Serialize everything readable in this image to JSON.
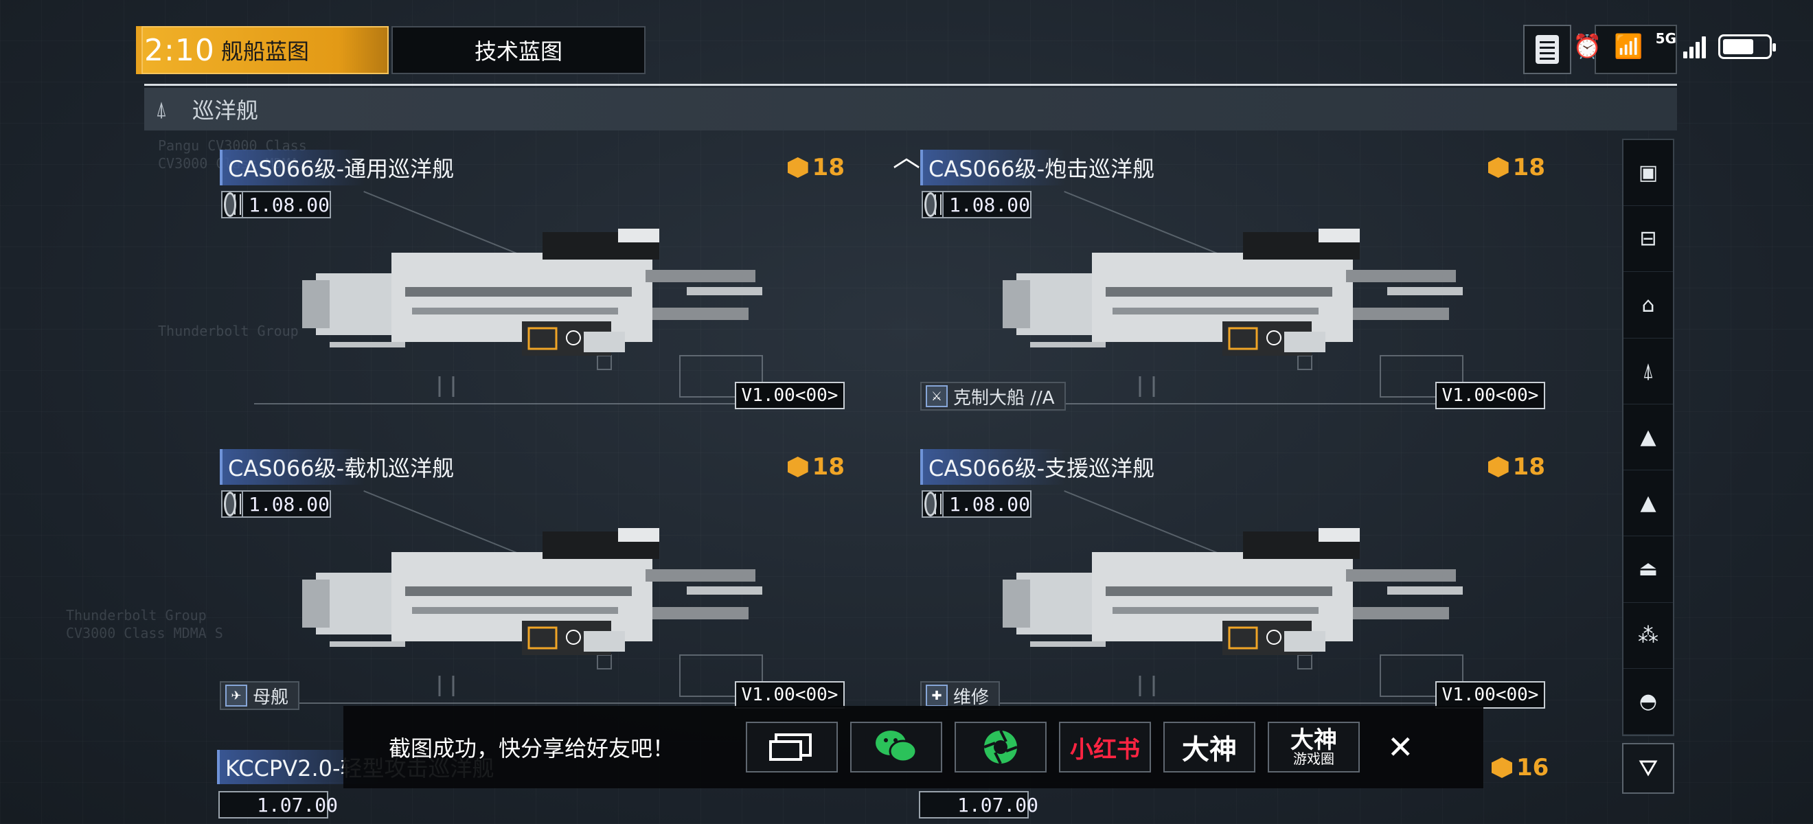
{
  "status": {
    "time": "2:10",
    "network": "5G"
  },
  "tabs": [
    {
      "label": "舰船蓝图",
      "active": true
    },
    {
      "label": "技术蓝图",
      "active": false
    }
  ],
  "category": {
    "icon": "cruiser-class-icon",
    "label": "巡洋舰"
  },
  "cards": [
    {
      "name": "CAS066级-通用巡洋舰",
      "cost": "18",
      "version": "1.08.00",
      "badge": "V1.00<00>",
      "tag": ""
    },
    {
      "name": "CAS066级-炮击巡洋舰",
      "cost": "18",
      "version": "1.08.00",
      "badge": "V1.00<00>",
      "tag": "克制大船 //A"
    },
    {
      "name": "CAS066级-载机巡洋舰",
      "cost": "18",
      "version": "1.08.00",
      "badge": "V1.00<00>",
      "tag": "母舰"
    },
    {
      "name": "CAS066级-支援巡洋舰",
      "cost": "18",
      "version": "1.08.00",
      "badge": "V1.00<00>",
      "tag": "维修"
    }
  ],
  "peek": {
    "left_name": "KCCPV2.0-轻型攻击巡洋舰",
    "left_version": "1.07.00",
    "right_version": "1.07.00",
    "right_cost": "16"
  },
  "rail_icons": [
    "flagship-icon",
    "destroyer-icon",
    "battlecruiser-icon",
    "cruiser-icon",
    "frigate-icon",
    "corvette-icon",
    "carrier-icon",
    "fighter-icon",
    "station-icon"
  ],
  "share": {
    "message": "截图成功，快分享给好友吧！",
    "buttons": [
      {
        "name": "screenshot-edit-button",
        "label": ""
      },
      {
        "name": "wechat-share-button",
        "label": ""
      },
      {
        "name": "moments-share-button",
        "label": ""
      },
      {
        "name": "xiaohongshu-share-button",
        "label": "小红书"
      },
      {
        "name": "dashen-share-button",
        "label": "大神"
      },
      {
        "name": "dashen-gamecircle-share-button",
        "label": "大神",
        "sub": "游戏圈"
      }
    ]
  },
  "colors": {
    "accent": "#e8a21f",
    "cost": "#f0a526",
    "name_bar": "#3e5fa5",
    "xiaohongshu": "#ff2442",
    "wechat": "#2bc25a"
  }
}
